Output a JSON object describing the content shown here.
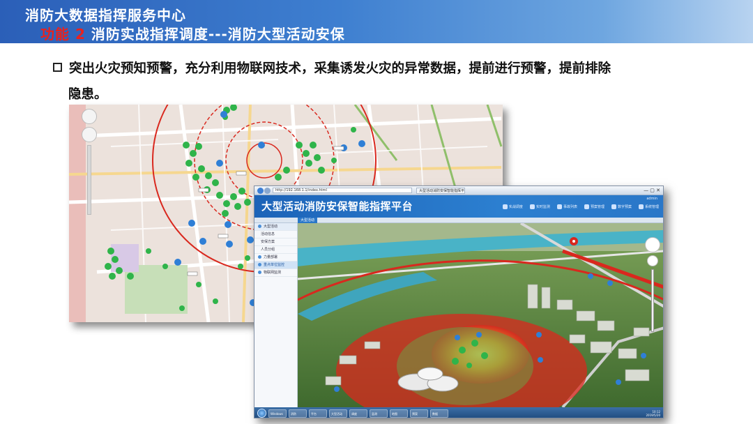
{
  "header": {
    "org": "消防大数据指挥服务中心",
    "function_label": "功能 2",
    "subtitle": "消防实战指挥调度---消防大型活动安保"
  },
  "bullet": {
    "line1": "突出火灾预知预警，充分利用物联网技术，采集诱发火灾的异常数据，提前进行预警，提前排除",
    "line2": "隐患。"
  },
  "app": {
    "title": "大型活动消防安保智能指挥平台",
    "browser": {
      "address": "http://192.168.1.1/index.html",
      "tab": "大型活动消防安保智能指挥平台"
    },
    "menu": [
      "实战调度",
      "实时监测",
      "事故列表",
      "预案管理",
      "数字预案",
      "系统管理"
    ],
    "user": "admin",
    "subtab": "大型活动",
    "sidebar": [
      {
        "label": "大型活动",
        "type": "head"
      },
      {
        "label": "活动信息",
        "type": "sub"
      },
      {
        "label": "安保方案",
        "type": "sub"
      },
      {
        "label": "人员分组",
        "type": "sub"
      },
      {
        "label": "力量部署",
        "type": "item"
      },
      {
        "label": "重点单位监控",
        "type": "active"
      },
      {
        "label": "物联网监测",
        "type": "item"
      }
    ],
    "taskbar": [
      "Windows",
      "消防",
      "平台",
      "大型活动",
      "调度",
      "监测",
      "地图",
      "预案",
      "数据"
    ],
    "clock": {
      "time": "10:12",
      "date": "2019/5/20"
    }
  },
  "colors": {
    "header_blue": "#2b5fb8",
    "function_red": "#e8221e",
    "ring_red": "#d9281e",
    "marker_green": "#2fb44a",
    "marker_blue": "#2f7fd6"
  },
  "icons": [
    "map-zoom-control",
    "compass-icon",
    "start-icon",
    "map-marker-icon",
    "fire-marker-icon"
  ]
}
